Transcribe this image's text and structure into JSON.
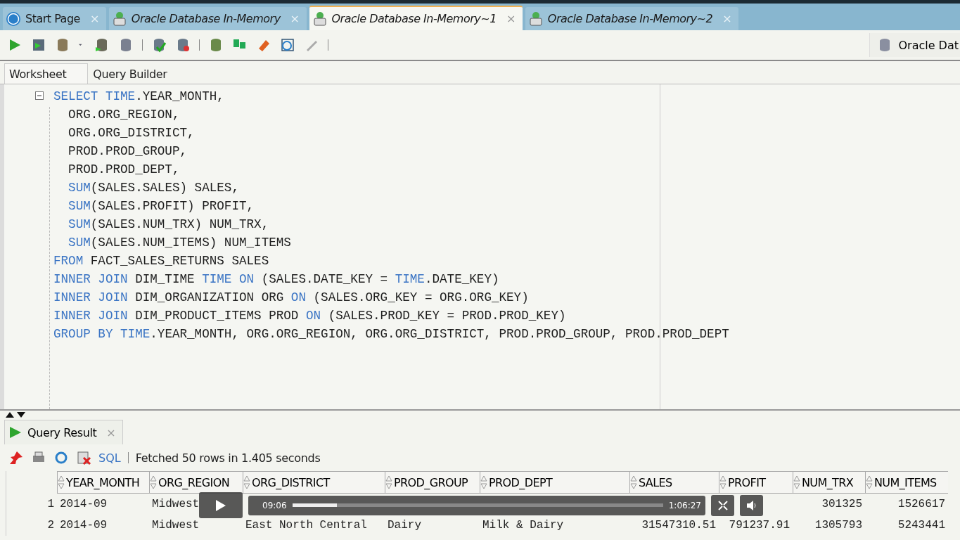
{
  "doc_tabs": [
    {
      "label": "Start Page",
      "kind": "help",
      "selected": false
    },
    {
      "label": "Oracle Database In-Memory",
      "kind": "sql",
      "selected": false
    },
    {
      "label": "Oracle Database In-Memory~1",
      "kind": "sql",
      "selected": true
    },
    {
      "label": "Oracle Database In-Memory~2",
      "kind": "sql",
      "selected": false
    }
  ],
  "close_glyph": "×",
  "connection": "Oracle Dat",
  "editor_tabs": [
    {
      "label": "Worksheet",
      "selected": true
    },
    {
      "label": "Query Builder",
      "selected": false
    }
  ],
  "code_lines": [
    [
      {
        "t": "SELECT ",
        "kind": "kw"
      },
      {
        "t": "TIME",
        "kind": "kw"
      },
      {
        "t": ".YEAR_MONTH,",
        "kind": "plain"
      }
    ],
    [
      {
        "t": "  ORG.ORG_REGION,",
        "kind": "plain"
      }
    ],
    [
      {
        "t": "  ORG.ORG_DISTRICT,",
        "kind": "plain"
      }
    ],
    [
      {
        "t": "  PROD.PROD_GROUP,",
        "kind": "plain"
      }
    ],
    [
      {
        "t": "  PROD.PROD_DEPT,",
        "kind": "plain"
      }
    ],
    [
      {
        "t": "  SUM",
        "kind": "kw"
      },
      {
        "t": "(SALES.SALES) SALES,",
        "kind": "plain"
      }
    ],
    [
      {
        "t": "  SUM",
        "kind": "kw"
      },
      {
        "t": "(SALES.PROFIT) PROFIT,",
        "kind": "plain"
      }
    ],
    [
      {
        "t": "  SUM",
        "kind": "kw"
      },
      {
        "t": "(SALES.NUM_TRX) NUM_TRX,",
        "kind": "plain"
      }
    ],
    [
      {
        "t": "  SUM",
        "kind": "kw"
      },
      {
        "t": "(SALES.NUM_ITEMS) NUM_ITEMS",
        "kind": "plain"
      }
    ],
    [
      {
        "t": "FROM ",
        "kind": "kw"
      },
      {
        "t": "FACT_SALES_RETURNS SALES",
        "kind": "plain"
      }
    ],
    [
      {
        "t": "INNER JOIN ",
        "kind": "kw"
      },
      {
        "t": "DIM_TIME ",
        "kind": "plain"
      },
      {
        "t": "TIME ON ",
        "kind": "kw"
      },
      {
        "t": "(SALES.DATE_KEY = ",
        "kind": "plain"
      },
      {
        "t": "TIME",
        "kind": "kw"
      },
      {
        "t": ".DATE_KEY)",
        "kind": "plain"
      }
    ],
    [
      {
        "t": "INNER JOIN ",
        "kind": "kw"
      },
      {
        "t": "DIM_ORGANIZATION ORG ",
        "kind": "plain"
      },
      {
        "t": "ON ",
        "kind": "kw"
      },
      {
        "t": "(SALES.ORG_KEY = ORG.ORG_KEY)",
        "kind": "plain"
      }
    ],
    [
      {
        "t": "INNER JOIN ",
        "kind": "kw"
      },
      {
        "t": "DIM_PRODUCT_ITEMS PROD ",
        "kind": "plain"
      },
      {
        "t": "ON ",
        "kind": "kw"
      },
      {
        "t": "(SALES.PROD_KEY = PROD.PROD_KEY)",
        "kind": "plain"
      }
    ],
    [
      {
        "t": "GROUP BY ",
        "kind": "kw"
      },
      {
        "t": "TIME",
        "kind": "kw"
      },
      {
        "t": ".YEAR_MONTH, ORG.ORG_REGION, ORG.ORG_DISTRICT, PROD.PROD_GROUP, PROD.PROD_DEPT",
        "kind": "plain"
      }
    ]
  ],
  "result_tab": {
    "label": "Query Result",
    "close": "×"
  },
  "result_toolbar": {
    "sql_label": "SQL",
    "status": "Fetched 50 rows in 1.405 seconds"
  },
  "table": {
    "columns": [
      "YEAR_MONTH",
      "ORG_REGION",
      "ORG_DISTRICT",
      "PROD_GROUP",
      "PROD_DEPT",
      "SALES",
      "PROFIT",
      "NUM_TRX",
      "NUM_ITEMS"
    ],
    "rows": [
      {
        "number": "1",
        "cells": [
          "2014-09",
          "Midwest",
          null,
          null,
          null,
          null,
          null,
          "301325",
          "1526617"
        ]
      },
      {
        "number": "2",
        "cells": [
          "2014-09",
          "Midwest",
          "East North Central",
          "Dairy",
          "Milk & Dairy",
          "31547310.51",
          "791237.91",
          "1305793",
          "5243441"
        ]
      }
    ]
  },
  "video_player": {
    "elapsed": "09:06",
    "duration": "1:06:27",
    "level": 0.12
  }
}
